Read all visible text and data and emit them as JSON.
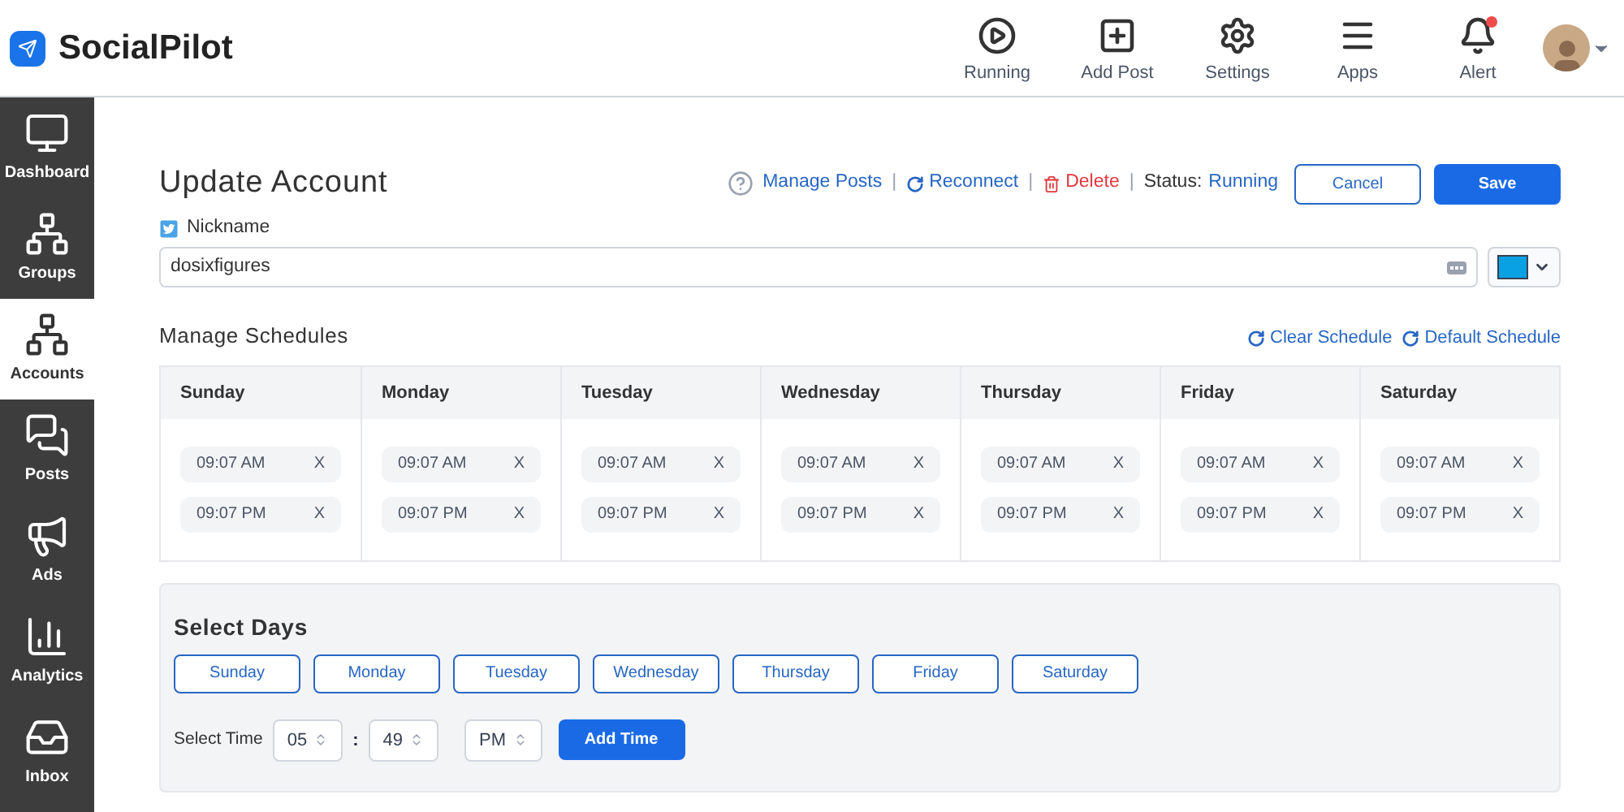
{
  "brand": {
    "name": "SocialPilot"
  },
  "top_nav": [
    {
      "kind": "running",
      "label": "Running"
    },
    {
      "kind": "add",
      "label": "Add Post"
    },
    {
      "kind": "settings",
      "label": "Settings"
    },
    {
      "kind": "apps",
      "label": "Apps"
    },
    {
      "kind": "alert",
      "label": "Alert",
      "has_notification": true
    }
  ],
  "sidebar": {
    "items": [
      {
        "kind": "dashboard",
        "label": "Dashboard",
        "selected": false
      },
      {
        "kind": "groups",
        "label": "Groups",
        "selected": false
      },
      {
        "kind": "accounts",
        "label": "Accounts",
        "selected": true
      },
      {
        "kind": "posts",
        "label": "Posts",
        "selected": false
      },
      {
        "kind": "ads",
        "label": "Ads",
        "selected": false
      },
      {
        "kind": "analytics",
        "label": "Analytics",
        "selected": false
      },
      {
        "kind": "inbox",
        "label": "Inbox",
        "selected": false
      }
    ]
  },
  "page": {
    "title": "Update Account",
    "actions": {
      "separators": [
        "|",
        "|",
        "|"
      ],
      "manage_posts": "Manage Posts",
      "reconnect": "Reconnect",
      "delete": "Delete",
      "status_label": "Status:",
      "status_value": "Running",
      "cancel": "Cancel",
      "save": "Save"
    }
  },
  "nickname": {
    "label": "Nickname",
    "value": "dosixfigures",
    "color": "#0aa0e4"
  },
  "schedules": {
    "title": "Manage Schedules",
    "clear": "Clear Schedule",
    "default": "Default Schedule",
    "days": [
      {
        "name": "Sunday",
        "times": [
          {
            "time": "09:07 AM",
            "remove": "X"
          },
          {
            "time": "09:07 PM",
            "remove": "X"
          }
        ]
      },
      {
        "name": "Monday",
        "times": [
          {
            "time": "09:07 AM",
            "remove": "X"
          },
          {
            "time": "09:07 PM",
            "remove": "X"
          }
        ]
      },
      {
        "name": "Tuesday",
        "times": [
          {
            "time": "09:07 AM",
            "remove": "X"
          },
          {
            "time": "09:07 PM",
            "remove": "X"
          }
        ]
      },
      {
        "name": "Wednesday",
        "times": [
          {
            "time": "09:07 AM",
            "remove": "X"
          },
          {
            "time": "09:07 PM",
            "remove": "X"
          }
        ]
      },
      {
        "name": "Thursday",
        "times": [
          {
            "time": "09:07 AM",
            "remove": "X"
          },
          {
            "time": "09:07 PM",
            "remove": "X"
          }
        ]
      },
      {
        "name": "Friday",
        "times": [
          {
            "time": "09:07 AM",
            "remove": "X"
          },
          {
            "time": "09:07 PM",
            "remove": "X"
          }
        ]
      },
      {
        "name": "Saturday",
        "times": [
          {
            "time": "09:07 AM",
            "remove": "X"
          },
          {
            "time": "09:07 PM",
            "remove": "X"
          }
        ]
      }
    ]
  },
  "select_days": {
    "title": "Select Days",
    "days": [
      {
        "label": "Sunday",
        "selected": false
      },
      {
        "label": "Monday",
        "selected": false
      },
      {
        "label": "Tuesday",
        "selected": false
      },
      {
        "label": "Wednesday",
        "selected": false
      },
      {
        "label": "Thursday",
        "selected": false
      },
      {
        "label": "Friday",
        "selected": false
      },
      {
        "label": "Saturday",
        "selected": false
      }
    ],
    "time_label": "Select Time",
    "hour": "05",
    "separator": ":",
    "minute": "49",
    "period": "PM",
    "add": "Add Time"
  }
}
